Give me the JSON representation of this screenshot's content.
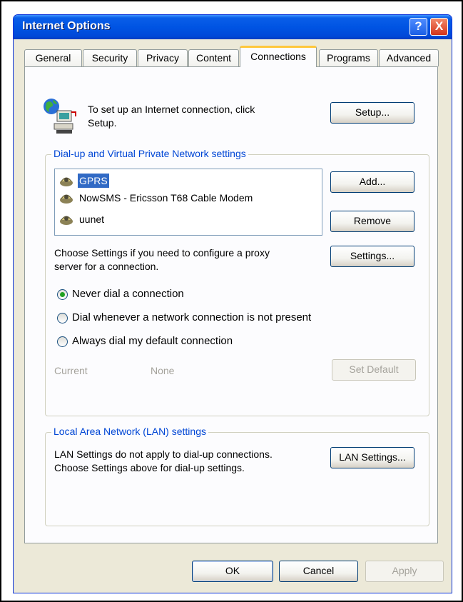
{
  "window": {
    "title": "Internet Options",
    "help_glyph": "?",
    "close_glyph": "X"
  },
  "tabs": [
    "General",
    "Security",
    "Privacy",
    "Content",
    "Connections",
    "Programs",
    "Advanced"
  ],
  "active_tab": "Connections",
  "setup": {
    "text_line1": "To set up an Internet connection, click",
    "text_line2": "Setup.",
    "button": "Setup..."
  },
  "dialup": {
    "group_title": "Dial-up and Virtual Private Network settings",
    "connections": [
      "GPRS",
      "NowSMS - Ericsson T68 Cable Modem",
      "uunet"
    ],
    "selected_connection": "GPRS",
    "add_button": "Add...",
    "remove_button": "Remove",
    "proxy_text_line1": "Choose Settings if you need to configure a proxy",
    "proxy_text_line2": "server for a connection.",
    "settings_button": "Settings...",
    "options": [
      "Never dial a connection",
      "Dial whenever a network connection is not present",
      "Always dial my default connection"
    ],
    "selected_option": "Never dial a connection",
    "current_label": "Current",
    "current_value": "None",
    "set_default_button": "Set Default"
  },
  "lan": {
    "group_title": "Local Area Network (LAN) settings",
    "text_line1": "LAN Settings do not apply to dial-up connections.",
    "text_line2": "Choose Settings above for dial-up settings.",
    "button": "LAN Settings..."
  },
  "footer": {
    "ok": "OK",
    "cancel": "Cancel",
    "apply": "Apply"
  },
  "icons": {
    "setup": "network-setup-icon",
    "connection": "dialup-connection-icon"
  },
  "colors": {
    "titlebar": "#0054e3",
    "dialog_bg": "#ece9d8",
    "group_title": "#0046d5",
    "selection": "#316ac5",
    "active_tab_accent": "#ffc83c"
  }
}
